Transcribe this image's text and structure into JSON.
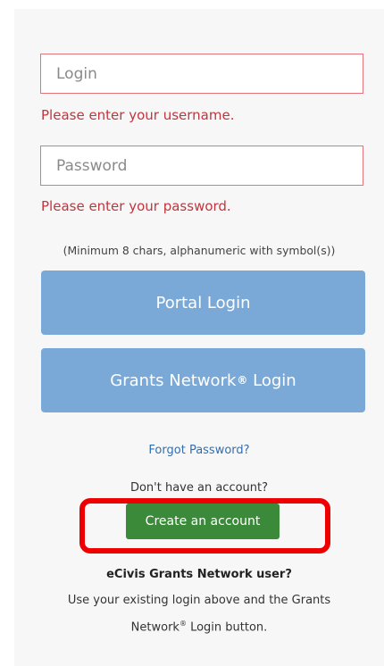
{
  "login": {
    "placeholder": "Login",
    "error": "Please enter your username."
  },
  "password": {
    "placeholder": "Password",
    "error": "Please enter your password.",
    "hint": "(Minimum 8 chars, alphanumeric with symbol(s))"
  },
  "buttons": {
    "portal_login": "Portal Login",
    "grants_network_login": "Grants Network",
    "grants_network_login_suffix": "Login",
    "registered_mark": "®"
  },
  "links": {
    "forgot_password": "Forgot Password?"
  },
  "signup": {
    "prompt": "Don't have an account?",
    "create_account": "Create an account"
  },
  "ecivis": {
    "title": "eCivis Grants Network user?",
    "text_part1": "Use your existing login above and the Grants Network",
    "text_part2": " Login button."
  },
  "colors": {
    "error": "#c0363f",
    "field_border": "#e5737b",
    "primary_button": "#7ba9d7",
    "create_button": "#3a8a3a",
    "highlight": "#ee0000",
    "link": "#2f6fb0"
  }
}
